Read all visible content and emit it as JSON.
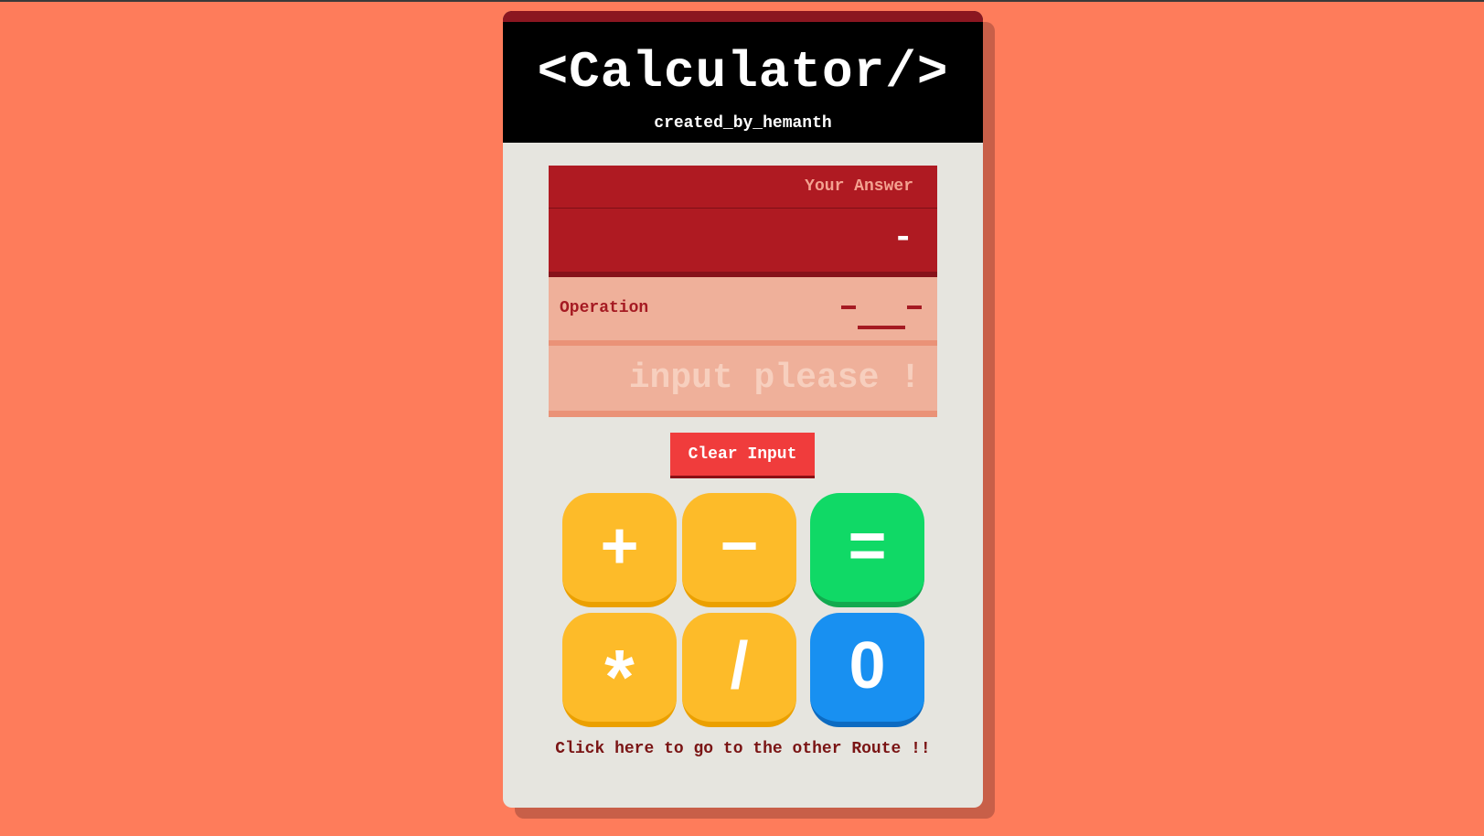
{
  "header": {
    "title": "<Calculator/>",
    "subtitle": "created_by_hemanth"
  },
  "answer": {
    "label": "Your Answer",
    "value": "-"
  },
  "operation": {
    "label": "Operation",
    "left_slot": "_",
    "operator_slot": "_",
    "right_slot": "_"
  },
  "input": {
    "placeholder": "input please !",
    "value": ""
  },
  "clear_button": {
    "label": "Clear Input"
  },
  "keys": {
    "plus": "+",
    "minus": "−",
    "equals": "=",
    "multiply": "*",
    "divide": "/",
    "zero": "0"
  },
  "route_link": {
    "label": "Click here to go to the other Route !!"
  },
  "colors": {
    "page_background": "#fe7c5b",
    "header_background": "#000000",
    "header_accent": "#8b1620",
    "card_background": "#e6e5df",
    "answer_background": "#af1a22",
    "operation_background": "#efb09a",
    "clear_button": "#f03c3c",
    "operator_key": "#fdbb29",
    "equals_key": "#10d966",
    "number_key": "#1890f1",
    "link_text": "#7a1414"
  }
}
